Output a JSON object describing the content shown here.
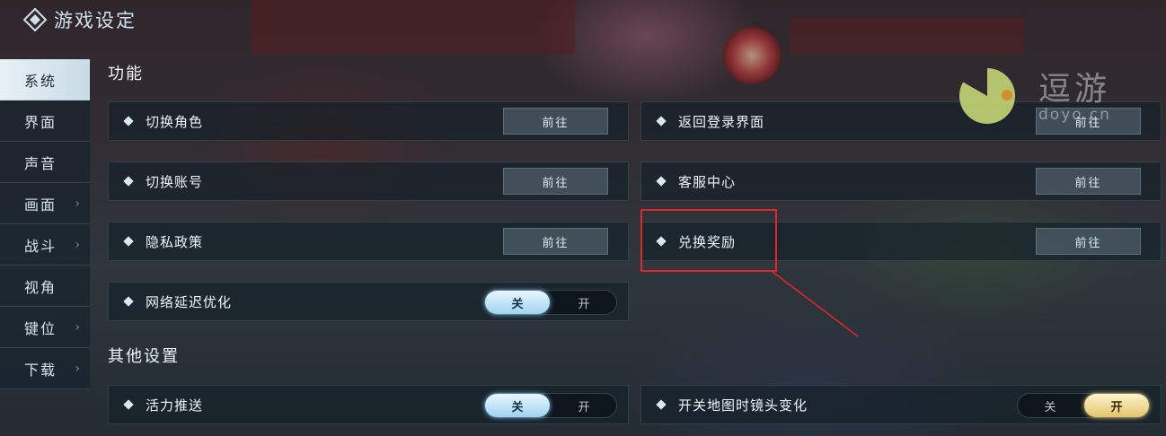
{
  "app": {
    "title": "游戏设定"
  },
  "sidebar": {
    "items": [
      {
        "label": "系统",
        "active": true,
        "has_submenu": false
      },
      {
        "label": "界面",
        "active": false,
        "has_submenu": false
      },
      {
        "label": "声音",
        "active": false,
        "has_submenu": false
      },
      {
        "label": "画面",
        "active": false,
        "has_submenu": true
      },
      {
        "label": "战斗",
        "active": false,
        "has_submenu": true
      },
      {
        "label": "视角",
        "active": false,
        "has_submenu": false
      },
      {
        "label": "键位",
        "active": false,
        "has_submenu": true
      },
      {
        "label": "下载",
        "active": false,
        "has_submenu": true
      }
    ]
  },
  "sections": {
    "function": {
      "title": "功能",
      "rows": [
        {
          "label": "切换角色",
          "button": "前往"
        },
        {
          "label": "返回登录界面",
          "button": "前往"
        },
        {
          "label": "切换账号",
          "button": "前往"
        },
        {
          "label": "客服中心",
          "button": "前往"
        },
        {
          "label": "隐私政策",
          "button": "前往"
        },
        {
          "label": "兑换奖励",
          "button": "前往",
          "highlighted": true
        },
        {
          "label": "网络延迟优化",
          "toggle": {
            "off": "关",
            "on": "开",
            "state": "off"
          }
        }
      ]
    },
    "other": {
      "title": "其他设置",
      "rows": [
        {
          "label": "活力推送",
          "toggle": {
            "off": "关",
            "on": "开",
            "state": "off"
          }
        },
        {
          "label": "开关地图时镜头变化",
          "toggle": {
            "off": "关",
            "on": "开",
            "state": "on"
          }
        }
      ]
    }
  },
  "watermark": {
    "cn": "逗游",
    "en": "doyo.cn"
  },
  "colors": {
    "highlight": "#e3262c",
    "toggle_off_active": "#9fd4f2",
    "toggle_on_active": "#e3c46b"
  }
}
